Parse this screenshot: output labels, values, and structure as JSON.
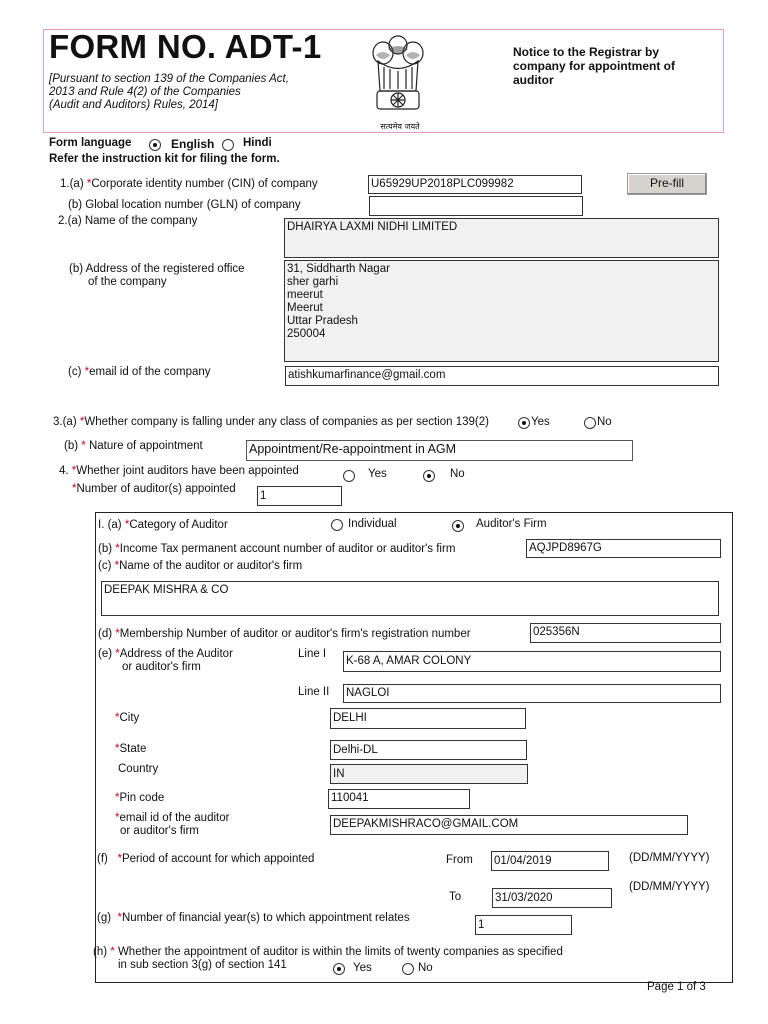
{
  "header": {
    "form_title": "FORM NO. ADT-1",
    "subtitle_lines": [
      "[Pursuant to section 139 of the Companies Act,",
      "2013 and Rule 4(2) of the Companies",
      "(Audit and Auditors) Rules, 2014]"
    ],
    "notice_lines": [
      "Notice to the Registrar by",
      "company for appointment of",
      "auditor"
    ],
    "emblem_caption": "सत्यमेव जयते",
    "emblem_icon": "national-emblem-icon"
  },
  "form_language": {
    "label": "Form language",
    "options": [
      {
        "label": "English",
        "selected": true
      },
      {
        "label": "Hindi",
        "selected": false
      }
    ]
  },
  "instruction": "Refer the instruction kit for filing the form.",
  "q1": {
    "a_prefix": "1.(a)",
    "a_label": "Corporate identity number (CIN) of company",
    "cin": "U65929UP2018PLC099982",
    "prefill_button": "Pre-fill",
    "b_label": "(b)  Global location number (GLN) of company",
    "gln": ""
  },
  "q2": {
    "a_label": "2.(a)  Name of the company",
    "company_name": "DHAIRYA LAXMI NIDHI LIMITED",
    "b_label_lines": [
      "(b) Address of the registered office",
      "of  the company"
    ],
    "address": "31, Siddharth Nagar\nsher garhi\nmeerut\nMeerut\nUttar Pradesh\n250004",
    "c_prefix": "(c)",
    "c_label": "email id of the company",
    "email": "atishkumarfinance@gmail.com"
  },
  "q3": {
    "a_prefix": "3.(a)",
    "a_label": "Whether company is falling under any class of companies as per section 139(2)",
    "a_options": [
      {
        "label": "Yes",
        "selected": true
      },
      {
        "label": "No",
        "selected": false
      }
    ],
    "b_prefix": "(b)",
    "b_label": "Nature of appointment",
    "nature": "Appointment/Re-appointment in AGM"
  },
  "q4": {
    "prefix": "4.",
    "label": "Whether joint auditors have been appointed",
    "options": [
      {
        "label": "Yes",
        "selected": false
      },
      {
        "label": "No",
        "selected": true
      }
    ],
    "count_label": "Number of auditor(s) appointed",
    "count": "1"
  },
  "auditor": {
    "a_prefix": "I. (a)",
    "a_label": "Category of Auditor",
    "category_options": [
      {
        "label": "Individual",
        "selected": false
      },
      {
        "label": "Auditor's Firm",
        "selected": true
      }
    ],
    "b_prefix": "(b)",
    "b_label": "Income Tax permanent account number of auditor or auditor's firm",
    "pan": "AQJPD8967G",
    "c_prefix": "(c)",
    "c_label": "Name of the auditor or auditor's firm",
    "name": "DEEPAK MISHRA & CO",
    "d_prefix": "(d)",
    "d_label": "Membership Number of auditor or auditor's firm's registration number",
    "membership": "025356N",
    "e_prefix": "(e)",
    "e_label_lines": [
      "Address of the Auditor",
      "or auditor's firm"
    ],
    "line1_label": "Line I",
    "line1": "K-68 A, AMAR COLONY",
    "line2_label": "Line II",
    "line2": "NAGLOI",
    "city_label": "City",
    "city": "DELHI",
    "state_label": "State",
    "state": "Delhi-DL",
    "country_label": "Country",
    "country": "IN",
    "pin_label": "Pin code",
    "pin": "110041",
    "email_label_lines": [
      "email id of the auditor",
      "or auditor's firm"
    ],
    "email": "DEEPAKMISHRACO@GMAIL.COM",
    "f_prefix": "(f)",
    "f_label": "Period of account for which appointed",
    "from_label": "From",
    "from": "01/04/2019",
    "to_label": "To",
    "to": "31/03/2020",
    "date_format": "(DD/MM/YYYY)",
    "g_prefix": "(g)",
    "g_label": "Number of financial year(s) to which appointment relates",
    "years": "1",
    "h_prefix": "(h)",
    "h_label_lines": [
      "Whether the appointment of auditor is within the limits of twenty companies as specified",
      "in sub section 3(g) of section 141"
    ],
    "h_options": [
      {
        "label": "Yes",
        "selected": true
      },
      {
        "label": "No",
        "selected": false
      }
    ]
  },
  "footer": {
    "page": "Page 1 of 3"
  }
}
